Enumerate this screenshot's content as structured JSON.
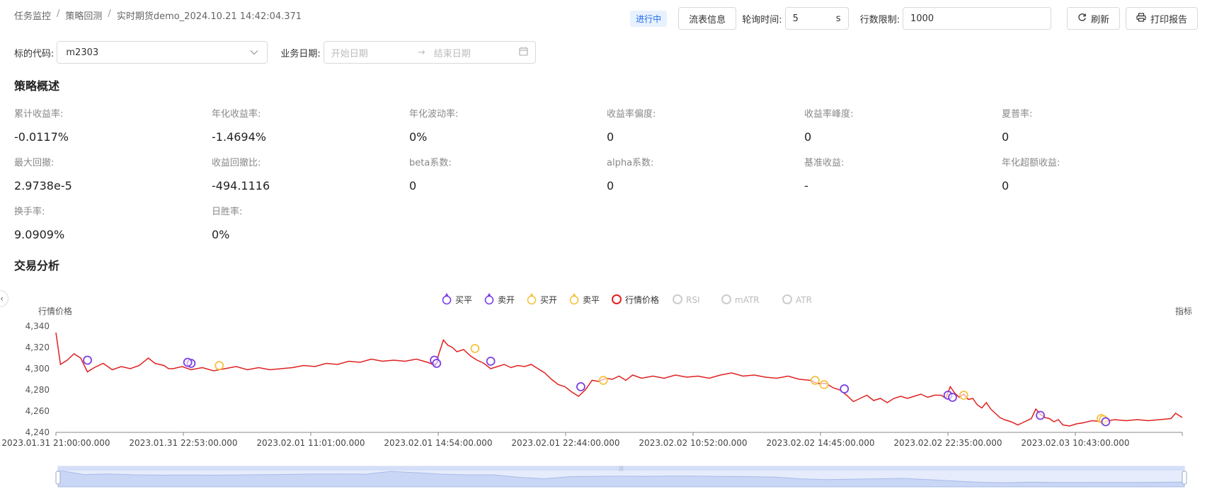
{
  "breadcrumb": {
    "items": [
      "任务监控",
      "策略回测",
      "实时期货demo_2024.10.21 14:42:04.371"
    ]
  },
  "toolbar": {
    "status": "进行中",
    "flow_btn": "流表信息",
    "poll_label": "轮询时间:",
    "poll_value": "5",
    "poll_unit": "s",
    "limit_label": "行数限制:",
    "limit_value": "1000",
    "refresh_btn": "刷新",
    "print_btn": "打印报告"
  },
  "filters": {
    "code_label": "标的代码:",
    "code_value": "m2303",
    "date_label": "业务日期:",
    "start_placeholder": "开始日期",
    "end_placeholder": "结束日期"
  },
  "overview": {
    "title": "策略概述",
    "metrics": [
      {
        "label": "累计收益率:",
        "value": "-0.0117%"
      },
      {
        "label": "年化收益率:",
        "value": "-1.4694%"
      },
      {
        "label": "年化波动率:",
        "value": "0%"
      },
      {
        "label": "收益率偏度:",
        "value": "0"
      },
      {
        "label": "收益率峰度:",
        "value": "0"
      },
      {
        "label": "夏普率:",
        "value": "0"
      },
      {
        "label": "最大回撤:",
        "value": "2.9738e-5"
      },
      {
        "label": "收益回撤比:",
        "value": "-494.1116"
      },
      {
        "label": "beta系数:",
        "value": "0"
      },
      {
        "label": "alpha系数:",
        "value": "0"
      },
      {
        "label": "基准收益:",
        "value": "-"
      },
      {
        "label": "年化超额收益:",
        "value": "0"
      },
      {
        "label": "换手率:",
        "value": "9.0909%"
      },
      {
        "label": "日胜率:",
        "value": "0%"
      }
    ]
  },
  "analysis": {
    "title": "交易分析"
  },
  "chart_data": {
    "type": "line",
    "ylabel": "行情价格",
    "ylabel_right": "指标",
    "ylim": [
      4240,
      4340
    ],
    "yticks": [
      4240,
      4260,
      4280,
      4300,
      4320,
      4340
    ],
    "x_ticks": [
      "2023.01.31 21:00:00.000",
      "2023.01.31 22:53:00.000",
      "2023.02.01 11:01:00.000",
      "2023.02.01 14:54:00.000",
      "2023.02.01 22:44:00.000",
      "2023.02.02 10:52:00.000",
      "2023.02.02 14:45:00.000",
      "2023.02.02 22:35:00.000",
      "2023.02.03 10:43:00.000"
    ],
    "legend": [
      {
        "name": "买平",
        "color": "#7b3fe4",
        "active": true
      },
      {
        "name": "卖开",
        "color": "#7b3fe4",
        "active": true
      },
      {
        "name": "买开",
        "color": "#f5c342",
        "active": true
      },
      {
        "name": "卖平",
        "color": "#f5c342",
        "active": true
      },
      {
        "name": "行情价格",
        "color": "#e02020",
        "active": true
      },
      {
        "name": "RSI",
        "color": "#cccccc",
        "active": false
      },
      {
        "name": "mATR",
        "color": "#cccccc",
        "active": false
      },
      {
        "name": "ATR",
        "color": "#cccccc",
        "active": false
      }
    ],
    "x_index_max": 1000,
    "series": [
      {
        "name": "行情价格",
        "color": "#e02020",
        "points": [
          [
            0,
            4334
          ],
          [
            4,
            4304
          ],
          [
            10,
            4308
          ],
          [
            16,
            4314
          ],
          [
            22,
            4310
          ],
          [
            28,
            4297
          ],
          [
            34,
            4301
          ],
          [
            42,
            4305
          ],
          [
            50,
            4299
          ],
          [
            58,
            4302
          ],
          [
            66,
            4300
          ],
          [
            74,
            4303
          ],
          [
            82,
            4310
          ],
          [
            88,
            4305
          ],
          [
            96,
            4303
          ],
          [
            100,
            4300
          ],
          [
            104,
            4300
          ],
          [
            112,
            4302
          ],
          [
            120,
            4299
          ],
          [
            130,
            4301
          ],
          [
            140,
            4298
          ],
          [
            150,
            4300
          ],
          [
            160,
            4302
          ],
          [
            170,
            4299
          ],
          [
            180,
            4301
          ],
          [
            190,
            4299
          ],
          [
            200,
            4300
          ],
          [
            210,
            4301
          ],
          [
            220,
            4303
          ],
          [
            230,
            4302
          ],
          [
            240,
            4305
          ],
          [
            250,
            4304
          ],
          [
            260,
            4307
          ],
          [
            270,
            4306
          ],
          [
            280,
            4309
          ],
          [
            290,
            4307
          ],
          [
            300,
            4308
          ],
          [
            310,
            4307
          ],
          [
            320,
            4309
          ],
          [
            330,
            4306
          ],
          [
            337,
            4303
          ],
          [
            340,
            4314
          ],
          [
            344,
            4327
          ],
          [
            348,
            4322
          ],
          [
            352,
            4320
          ],
          [
            356,
            4316
          ],
          [
            362,
            4318
          ],
          [
            368,
            4312
          ],
          [
            374,
            4308
          ],
          [
            380,
            4305
          ],
          [
            386,
            4300
          ],
          [
            392,
            4302
          ],
          [
            398,
            4304
          ],
          [
            404,
            4301
          ],
          [
            410,
            4303
          ],
          [
            416,
            4302
          ],
          [
            422,
            4304
          ],
          [
            428,
            4300
          ],
          [
            434,
            4296
          ],
          [
            440,
            4290
          ],
          [
            446,
            4285
          ],
          [
            452,
            4283
          ],
          [
            458,
            4278
          ],
          [
            464,
            4274
          ],
          [
            470,
            4280
          ],
          [
            476,
            4289
          ],
          [
            482,
            4288
          ],
          [
            488,
            4291
          ],
          [
            494,
            4290
          ],
          [
            500,
            4293
          ],
          [
            506,
            4289
          ],
          [
            512,
            4294
          ],
          [
            520,
            4291
          ],
          [
            530,
            4293
          ],
          [
            540,
            4291
          ],
          [
            550,
            4294
          ],
          [
            560,
            4292
          ],
          [
            570,
            4293
          ],
          [
            580,
            4291
          ],
          [
            590,
            4294
          ],
          [
            600,
            4296
          ],
          [
            610,
            4293
          ],
          [
            620,
            4294
          ],
          [
            630,
            4292
          ],
          [
            640,
            4291
          ],
          [
            650,
            4293
          ],
          [
            660,
            4290
          ],
          [
            670,
            4289
          ],
          [
            676,
            4286
          ],
          [
            684,
            4286
          ],
          [
            690,
            4282
          ],
          [
            696,
            4280
          ],
          [
            702,
            4275
          ],
          [
            708,
            4269
          ],
          [
            714,
            4272
          ],
          [
            720,
            4275
          ],
          [
            726,
            4270
          ],
          [
            732,
            4272
          ],
          [
            738,
            4268
          ],
          [
            744,
            4272
          ],
          [
            750,
            4274
          ],
          [
            756,
            4272
          ],
          [
            762,
            4274
          ],
          [
            768,
            4276
          ],
          [
            774,
            4273
          ],
          [
            780,
            4275
          ],
          [
            786,
            4275
          ],
          [
            790,
            4272
          ],
          [
            794,
            4283
          ],
          [
            798,
            4277
          ],
          [
            802,
            4273
          ],
          [
            806,
            4276
          ],
          [
            810,
            4271
          ],
          [
            814,
            4272
          ],
          [
            818,
            4266
          ],
          [
            822,
            4263
          ],
          [
            826,
            4268
          ],
          [
            830,
            4262
          ],
          [
            834,
            4258
          ],
          [
            838,
            4254
          ],
          [
            842,
            4252
          ],
          [
            848,
            4250
          ],
          [
            854,
            4247
          ],
          [
            860,
            4250
          ],
          [
            866,
            4253
          ],
          [
            870,
            4262
          ],
          [
            874,
            4257
          ],
          [
            878,
            4254
          ],
          [
            882,
            4253
          ],
          [
            886,
            4250
          ],
          [
            890,
            4252
          ],
          [
            894,
            4247
          ],
          [
            900,
            4246
          ],
          [
            906,
            4248
          ],
          [
            912,
            4249
          ],
          [
            920,
            4251
          ],
          [
            930,
            4250
          ],
          [
            940,
            4252
          ],
          [
            950,
            4251
          ],
          [
            960,
            4252
          ],
          [
            970,
            4251
          ],
          [
            980,
            4252
          ],
          [
            990,
            4253
          ],
          [
            994,
            4258
          ],
          [
            1000,
            4254
          ]
        ]
      }
    ],
    "markers": [
      {
        "type": "卖开",
        "x": 28,
        "y": 4308
      },
      {
        "type": "买平",
        "x": 120,
        "y": 4305
      },
      {
        "type": "卖开",
        "x": 117,
        "y": 4306
      },
      {
        "type": "卖平",
        "x": 145,
        "y": 4303
      },
      {
        "type": "买平",
        "x": 336,
        "y": 4308
      },
      {
        "type": "卖开",
        "x": 338,
        "y": 4305
      },
      {
        "type": "卖平",
        "x": 372,
        "y": 4319
      },
      {
        "type": "卖开",
        "x": 386,
        "y": 4307
      },
      {
        "type": "买平",
        "x": 466,
        "y": 4283
      },
      {
        "type": "卖平",
        "x": 486,
        "y": 4289
      },
      {
        "type": "买开",
        "x": 674,
        "y": 4289
      },
      {
        "type": "卖平",
        "x": 682,
        "y": 4285
      },
      {
        "type": "买平",
        "x": 700,
        "y": 4281
      },
      {
        "type": "买平",
        "x": 792,
        "y": 4275
      },
      {
        "type": "卖开",
        "x": 796,
        "y": 4273
      },
      {
        "type": "买开",
        "x": 806,
        "y": 4275
      },
      {
        "type": "卖开",
        "x": 874,
        "y": 4256
      },
      {
        "type": "卖平",
        "x": 928,
        "y": 4253
      },
      {
        "type": "买开",
        "x": 930,
        "y": 4252
      },
      {
        "type": "卖开",
        "x": 932,
        "y": 4250
      }
    ],
    "navigator_trend": [
      4334,
      4304,
      4308,
      4302,
      4300,
      4301,
      4300,
      4301,
      4303,
      4305,
      4307,
      4308,
      4306,
      4325,
      4316,
      4306,
      4302,
      4302,
      4285,
      4275,
      4290,
      4292,
      4293,
      4292,
      4294,
      4293,
      4291,
      4290,
      4286,
      4275,
      4270,
      4272,
      4275,
      4278,
      4270,
      4260,
      4252,
      4248,
      4253,
      4250,
      4250,
      4251,
      4251,
      4252,
      4254
    ]
  }
}
